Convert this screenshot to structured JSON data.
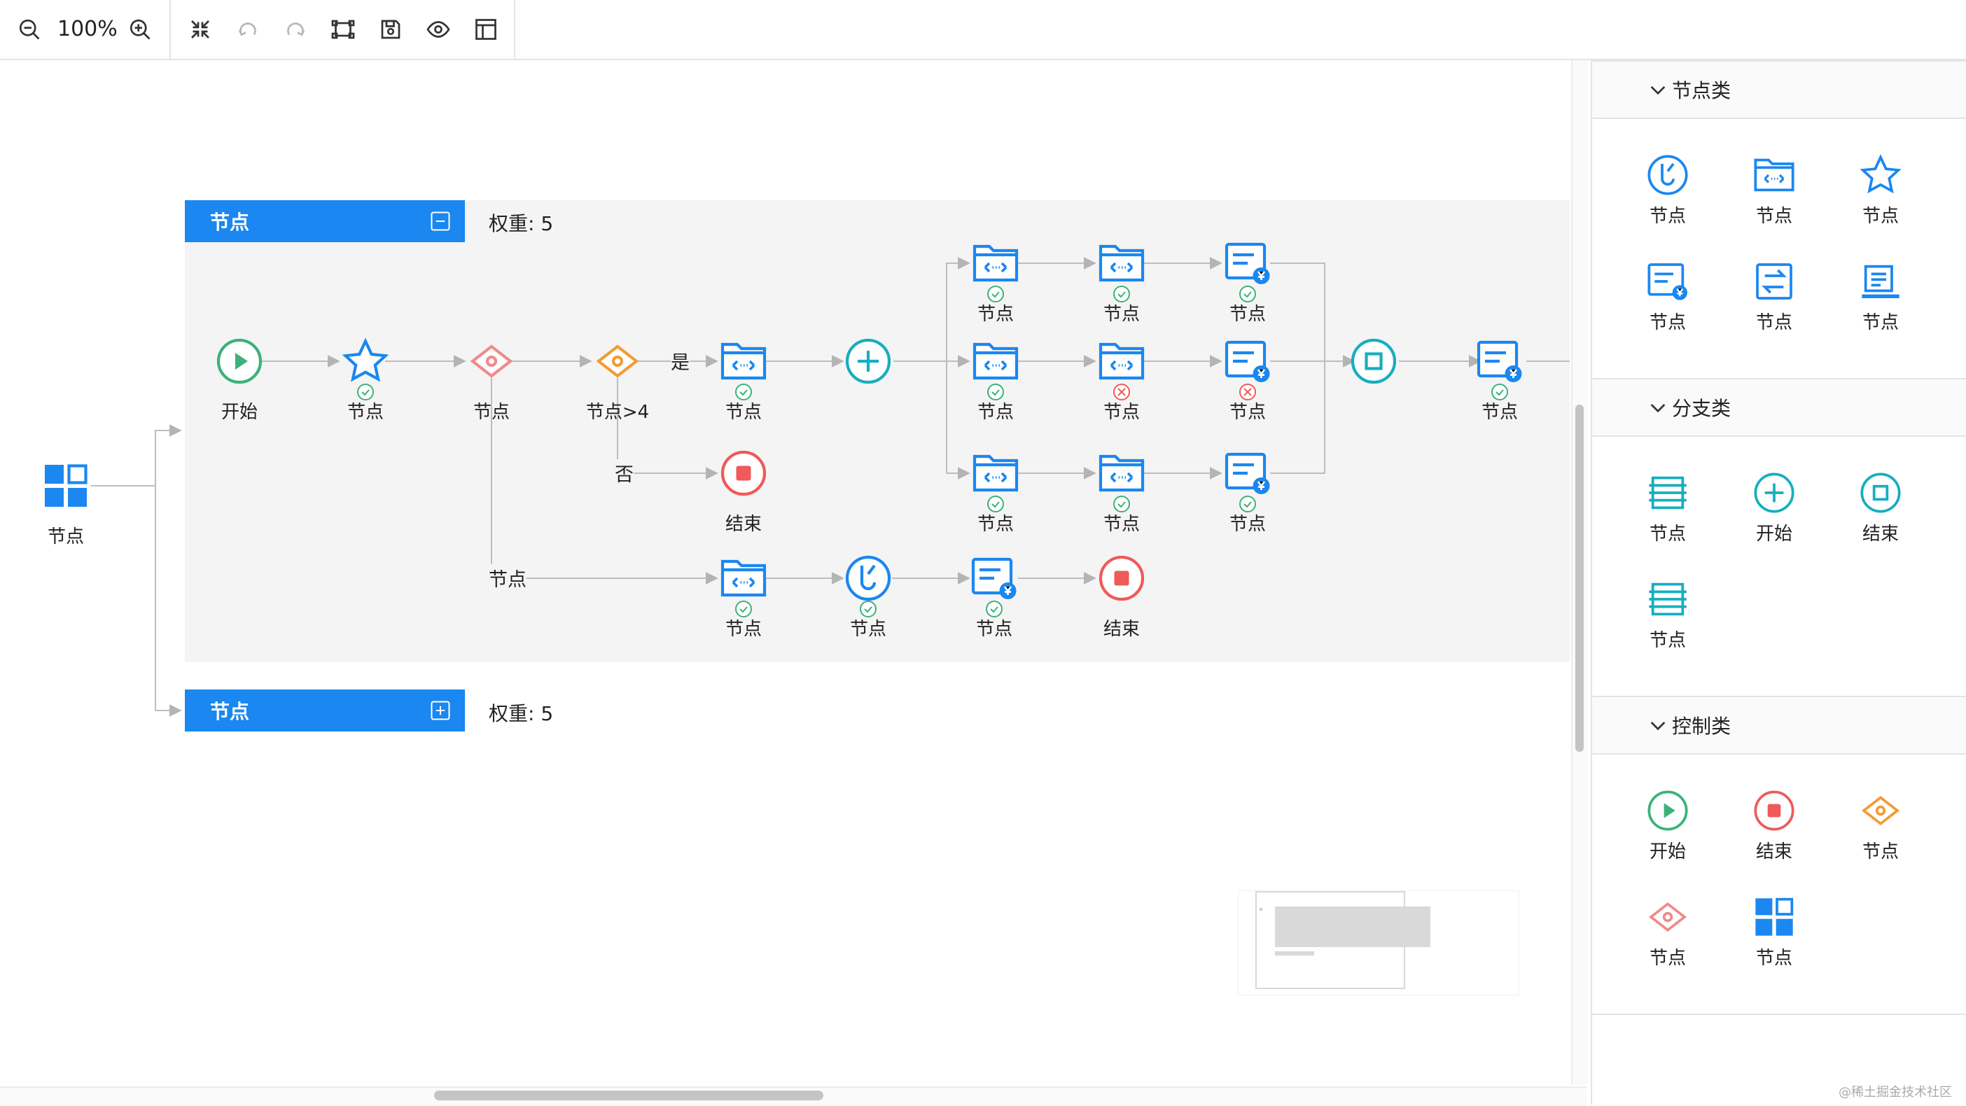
{
  "toolbar": {
    "zoom": "100%",
    "buttons": [
      "zoom-out-icon",
      "zoom-in-icon",
      "fit-view-icon",
      "undo-icon",
      "redo-icon",
      "auto-layout-icon",
      "save-icon",
      "preview-icon",
      "layout-icon"
    ]
  },
  "canvas": {
    "start_node_label": "节点",
    "groups": [
      {
        "title": "节点",
        "weight": "权重: 5",
        "expanded": true
      },
      {
        "title": "节点",
        "weight": "权重: 5",
        "expanded": false
      }
    ],
    "nodes": {
      "start": "开始",
      "n1": "节点",
      "n2": "节点",
      "n3": "节点>4",
      "n4": "节点",
      "end1": "结束",
      "b1": "节点",
      "b2": "节点",
      "b3": "节点",
      "c1": "节点",
      "c2": "节点",
      "c3": "节点",
      "d1": "节点",
      "d2": "节点",
      "d3": "节点",
      "out": "节点",
      "l1": "节点",
      "l2": "节点",
      "l3": "节点",
      "end2": "结束"
    },
    "edge_labels": {
      "yes": "是",
      "no": "否",
      "branch": "节点"
    }
  },
  "panel": {
    "sections": [
      {
        "title": "节点类",
        "items": [
          "节点",
          "节点",
          "节点",
          "节点",
          "节点",
          "节点"
        ]
      },
      {
        "title": "分支类",
        "items": [
          "节点",
          "开始",
          "结束",
          "节点"
        ]
      },
      {
        "title": "控制类",
        "items": [
          "开始",
          "结束",
          "节点",
          "节点",
          "节点"
        ]
      }
    ]
  },
  "colors": {
    "primary": "#1b87f0",
    "green": "#3bb27a",
    "red": "#ef5a5a",
    "orange": "#f29b35",
    "pink": "#f08a8a",
    "teal": "#16aebf"
  },
  "watermark": "@稀土掘金技术社区"
}
